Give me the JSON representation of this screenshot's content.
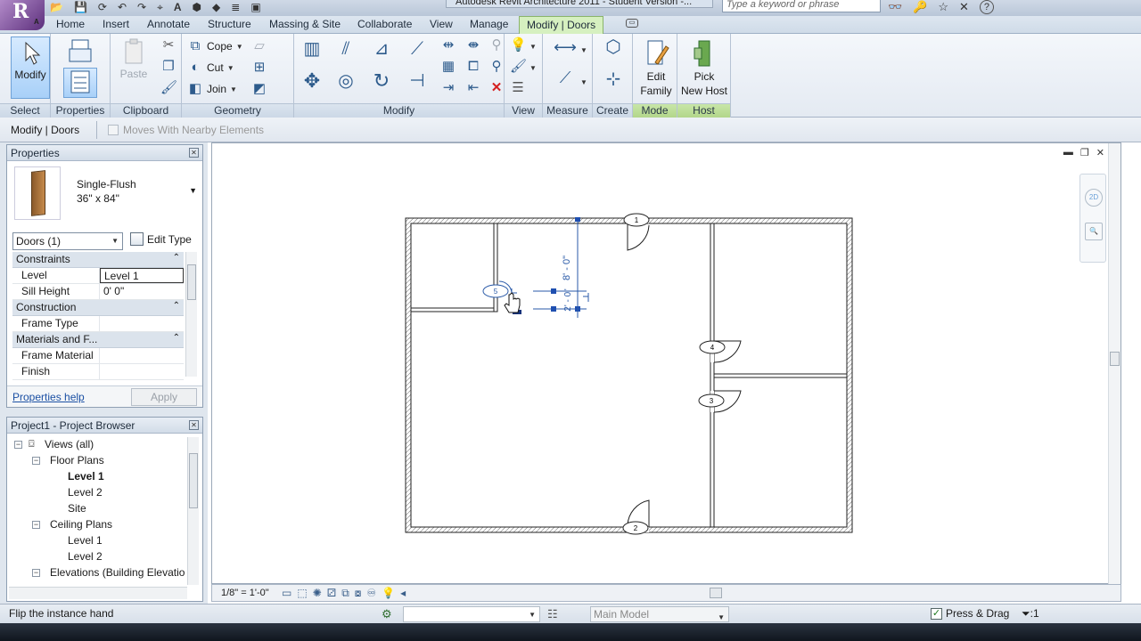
{
  "titlebar": {
    "window_title": "Autodesk Revit Architecture 2011 - Student Version -...",
    "search_placeholder": "Type a keyword or phrase",
    "app_letter": "R",
    "app_sub": "A"
  },
  "tabs": [
    "Home",
    "Insert",
    "Annotate",
    "Structure",
    "Massing & Site",
    "Collaborate",
    "View",
    "Manage",
    "Modify | Doors"
  ],
  "ribbon": {
    "select": {
      "modify_label": "Modify",
      "panel": "Select"
    },
    "properties": {
      "panel": "Properties"
    },
    "clipboard": {
      "paste_label": "Paste",
      "panel": "Clipboard"
    },
    "geometry": {
      "cope": "Cope",
      "cut": "Cut",
      "join": "Join",
      "panel": "Geometry"
    },
    "modify": {
      "panel": "Modify"
    },
    "view": {
      "panel": "View"
    },
    "measure": {
      "panel": "Measure"
    },
    "create": {
      "panel": "Create"
    },
    "mode": {
      "edit_family_1": "Edit",
      "edit_family_2": "Family",
      "panel": "Mode"
    },
    "host": {
      "pick_1": "Pick",
      "pick_2": "New Host",
      "panel": "Host"
    }
  },
  "optionsbar": {
    "context": "Modify | Doors",
    "moves_with": "Moves With Nearby Elements",
    "moves_with_checked": false
  },
  "properties": {
    "title": "Properties",
    "type_name": "Single-Flush",
    "type_size": "36\" x 84\"",
    "instance_filter": "Doors (1)",
    "edit_type": "Edit Type",
    "groups": [
      {
        "name": "Constraints",
        "rows": [
          {
            "name": "Level",
            "value": "Level 1"
          },
          {
            "name": "Sill Height",
            "value": "0'  0\""
          }
        ]
      },
      {
        "name": "Construction",
        "rows": [
          {
            "name": "Frame Type",
            "value": ""
          }
        ]
      },
      {
        "name": "Materials and F...",
        "rows": [
          {
            "name": "Frame Material",
            "value": ""
          },
          {
            "name": "Finish",
            "value": ""
          }
        ]
      }
    ],
    "help_link": "Properties help",
    "apply": "Apply"
  },
  "browser": {
    "title": "Project1 - Project Browser",
    "items": [
      {
        "label": "Views (all)",
        "level": 0,
        "expander": "−",
        "bold": false
      },
      {
        "label": "Floor Plans",
        "level": 1,
        "expander": "−",
        "bold": false
      },
      {
        "label": "Level 1",
        "level": 2,
        "expander": "",
        "bold": true
      },
      {
        "label": "Level 2",
        "level": 2,
        "expander": "",
        "bold": false
      },
      {
        "label": "Site",
        "level": 2,
        "expander": "",
        "bold": false
      },
      {
        "label": "Ceiling Plans",
        "level": 1,
        "expander": "−",
        "bold": false
      },
      {
        "label": "Level 1",
        "level": 2,
        "expander": "",
        "bold": false
      },
      {
        "label": "Level 2",
        "level": 2,
        "expander": "",
        "bold": false
      },
      {
        "label": "Elevations (Building Elevatio",
        "level": 1,
        "expander": "−",
        "bold": false
      }
    ]
  },
  "drawing": {
    "dim_vertical": "8' - 0\"",
    "dim_small": "2' - 0\"",
    "door_tags": [
      "1",
      "2",
      "3",
      "4",
      "5"
    ]
  },
  "viewbar": {
    "scale": "1/8\" = 1'-0\""
  },
  "status": {
    "message": "Flip the instance hand",
    "workset": "",
    "design_option": "Main Model",
    "press_drag": "Press & Drag",
    "press_drag_checked": true,
    "filter_count": ":1"
  }
}
